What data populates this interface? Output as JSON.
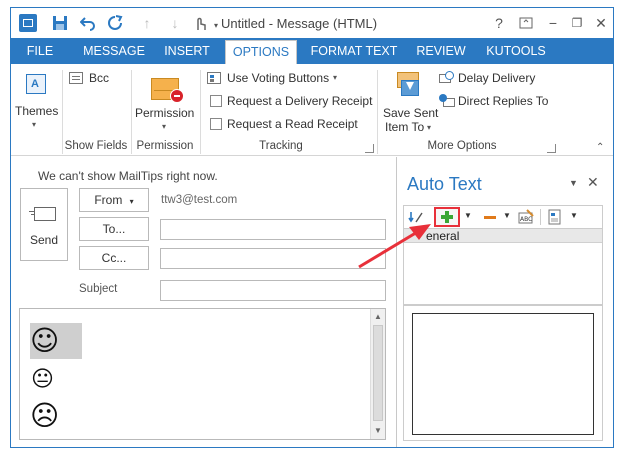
{
  "window": {
    "title": "Untitled - Message (HTML)",
    "help": "?",
    "minimize": "−",
    "restore": "❐",
    "close": "✕"
  },
  "tabs": [
    {
      "label": "FILE"
    },
    {
      "label": "MESSAGE"
    },
    {
      "label": "INSERT"
    },
    {
      "label": "OPTIONS"
    },
    {
      "label": "FORMAT TEXT"
    },
    {
      "label": "REVIEW"
    },
    {
      "label": "KUTOOLS"
    }
  ],
  "ribbon": {
    "themes": {
      "label": "Themes"
    },
    "bcc": {
      "label": "Bcc"
    },
    "show_fields": {
      "label": "Show Fields"
    },
    "permission_button": {
      "label": "Permission"
    },
    "permission_group": {
      "label": "Permission"
    },
    "voting": {
      "label": "Use Voting Buttons"
    },
    "delivery_receipt": {
      "label": "Request a Delivery Receipt"
    },
    "read_receipt": {
      "label": "Request a Read Receipt"
    },
    "tracking": {
      "label": "Tracking"
    },
    "save_sent_1": {
      "label": "Save Sent"
    },
    "save_sent_2": {
      "label": "Item To"
    },
    "delay_delivery": {
      "label": "Delay Delivery"
    },
    "direct_replies": {
      "label": "Direct Replies To"
    },
    "more_options": {
      "label": "More Options"
    }
  },
  "compose": {
    "mailtips": "We can't show MailTips right now.",
    "send": "Send",
    "from_label": "From",
    "from_value": "ttw3@test.com",
    "to_label": "To...",
    "cc_label": "Cc...",
    "subject_label": "Subject",
    "to_value": "",
    "cc_value": "",
    "subject_value": "",
    "emoticons": [
      "☺",
      "😐",
      "☹"
    ]
  },
  "autotext": {
    "title": "Auto Text",
    "category": "eneral"
  },
  "colors": {
    "accent": "#2b79c2",
    "annotation": "#e8303a",
    "add_icon": "#3aa635",
    "remove_icon": "#e07a1a"
  }
}
